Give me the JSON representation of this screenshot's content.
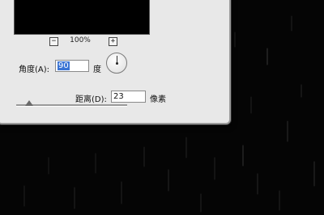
{
  "preview": {
    "zoom_out": "−",
    "zoom_level": "100%",
    "zoom_in": "+"
  },
  "angle": {
    "label": "角度(A):",
    "value": "90",
    "unit": "度"
  },
  "distance": {
    "label": "距离(D):",
    "value": "23",
    "unit": "像素"
  },
  "slider": {
    "fraction": 0.12
  }
}
